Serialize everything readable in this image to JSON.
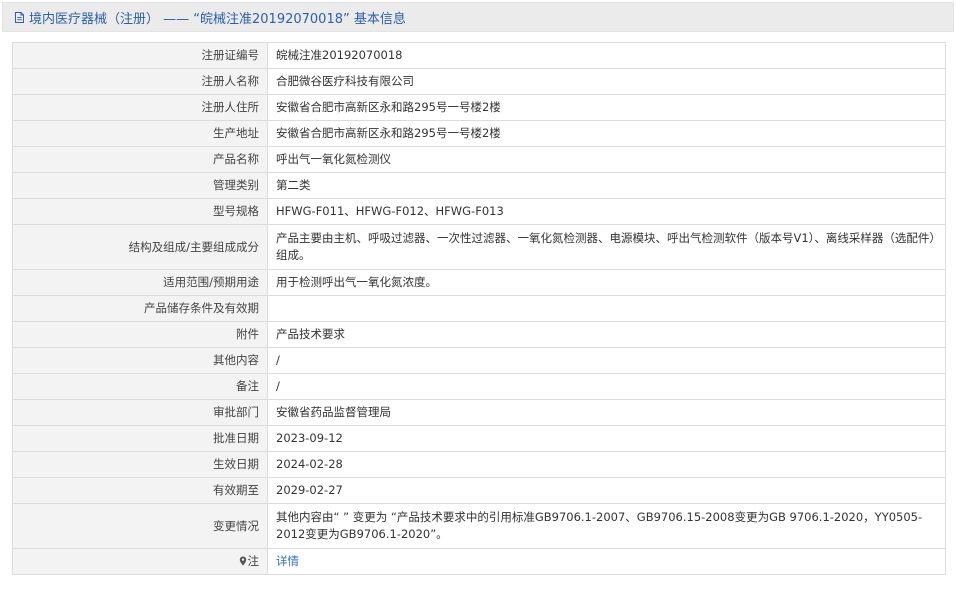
{
  "header": {
    "title": "境内医疗器械（注册） —— “皖械注准20192070018” 基本信息"
  },
  "rows": [
    {
      "label": "注册证编号",
      "value": "皖械注准20192070018"
    },
    {
      "label": "注册人名称",
      "value": "合肥微谷医疗科技有限公司"
    },
    {
      "label": "注册人住所",
      "value": "安徽省合肥市高新区永和路295号一号楼2楼"
    },
    {
      "label": "生产地址",
      "value": "安徽省合肥市高新区永和路295号一号楼2楼"
    },
    {
      "label": "产品名称",
      "value": "呼出气一氧化氮检测仪"
    },
    {
      "label": "管理类别",
      "value": "第二类"
    },
    {
      "label": "型号规格",
      "value": "HFWG-F011、HFWG-F012、HFWG-F013"
    },
    {
      "label": "结构及组成/主要组成成分",
      "value": "产品主要由主机、呼吸过滤器、一次性过滤器、一氧化氮检测器、电源模块、呼出气检测软件（版本号V1）、离线采样器（选配件）组成。"
    },
    {
      "label": "适用范围/预期用途",
      "value": "用于检测呼出气一氧化氮浓度。"
    },
    {
      "label": "产品储存条件及有效期",
      "value": ""
    },
    {
      "label": "附件",
      "value": "产品技术要求"
    },
    {
      "label": "其他内容",
      "value": "/"
    },
    {
      "label": "备注",
      "value": "/"
    },
    {
      "label": "审批部门",
      "value": "安徽省药品监督管理局"
    },
    {
      "label": "批准日期",
      "value": "2023-09-12"
    },
    {
      "label": "生效日期",
      "value": "2024-02-28"
    },
    {
      "label": "有效期至",
      "value": "2029-02-27"
    },
    {
      "label": "变更情况",
      "value": "其他内容由“ ” 变更为 “产品技术要求中的引用标准GB9706.1-2007、GB9706.15-2008变更为GB 9706.1-2020，YY0505-2012变更为GB9706.1-2020”。"
    }
  ],
  "note": {
    "label": "注",
    "link_text": "详情"
  },
  "colors": {
    "title_text": "#2e5fa8",
    "title_bg": "#ebebeb",
    "label_bg": "#f3f3f3",
    "link": "#2e6fc2",
    "border": "#dcdcdc"
  }
}
